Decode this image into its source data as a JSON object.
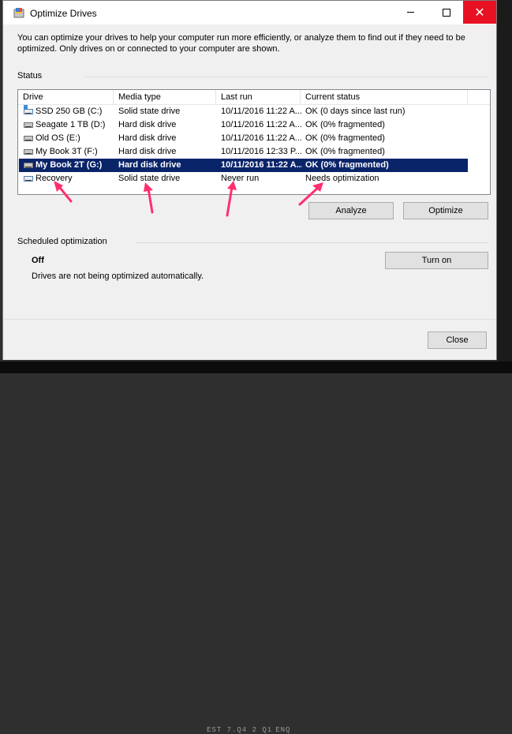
{
  "window": {
    "title": "Optimize Drives"
  },
  "intro_text": "You can optimize your drives to help your computer run more efficiently, or analyze them to find out if they need to be optimized. Only drives on or connected to your computer are shown.",
  "status_label": "Status",
  "columns": [
    "Drive",
    "Media type",
    "Last run",
    "Current status"
  ],
  "drives": [
    {
      "name": "SSD 250 GB (C:)",
      "media": "Solid state drive",
      "last_run": "10/11/2016 11:22 A...",
      "status": "OK (0 days since last run)",
      "icon": "ssd-system-drive-icon"
    },
    {
      "name": "Seagate 1 TB (D:)",
      "media": "Hard disk drive",
      "last_run": "10/11/2016 11:22 A...",
      "status": "OK (0% fragmented)",
      "icon": "hard-drive-icon"
    },
    {
      "name": "Old OS (E:)",
      "media": "Hard disk drive",
      "last_run": "10/11/2016 11:22 A...",
      "status": "OK (0% fragmented)",
      "icon": "hard-drive-icon"
    },
    {
      "name": "My Book 3T (F:)",
      "media": "Hard disk drive",
      "last_run": "10/11/2016 12:33 P...",
      "status": "OK (0% fragmented)",
      "icon": "hard-drive-icon"
    },
    {
      "name": "My Book 2T (G:)",
      "media": "Hard disk drive",
      "last_run": "10/11/2016 11:22 A...",
      "status": "OK (0% fragmented)",
      "icon": "hard-drive-icon",
      "selected": true
    },
    {
      "name": "Recovery",
      "media": "Solid state drive",
      "last_run": "Never run",
      "status": "Needs optimization",
      "icon": "ssd-drive-icon"
    }
  ],
  "buttons": {
    "analyze": "Analyze",
    "optimize": "Optimize",
    "turn_on": "Turn on",
    "close": "Close"
  },
  "scheduled": {
    "label": "Scheduled optimization",
    "state": "Off",
    "description": "Drives are not being optimized automatically."
  },
  "bottom_text": "EST  7.Q4  2 Q1 ENQ",
  "colors": {
    "selection": "#0a246a",
    "arrow": "#ff2f6e",
    "close_button": "#e81123"
  }
}
